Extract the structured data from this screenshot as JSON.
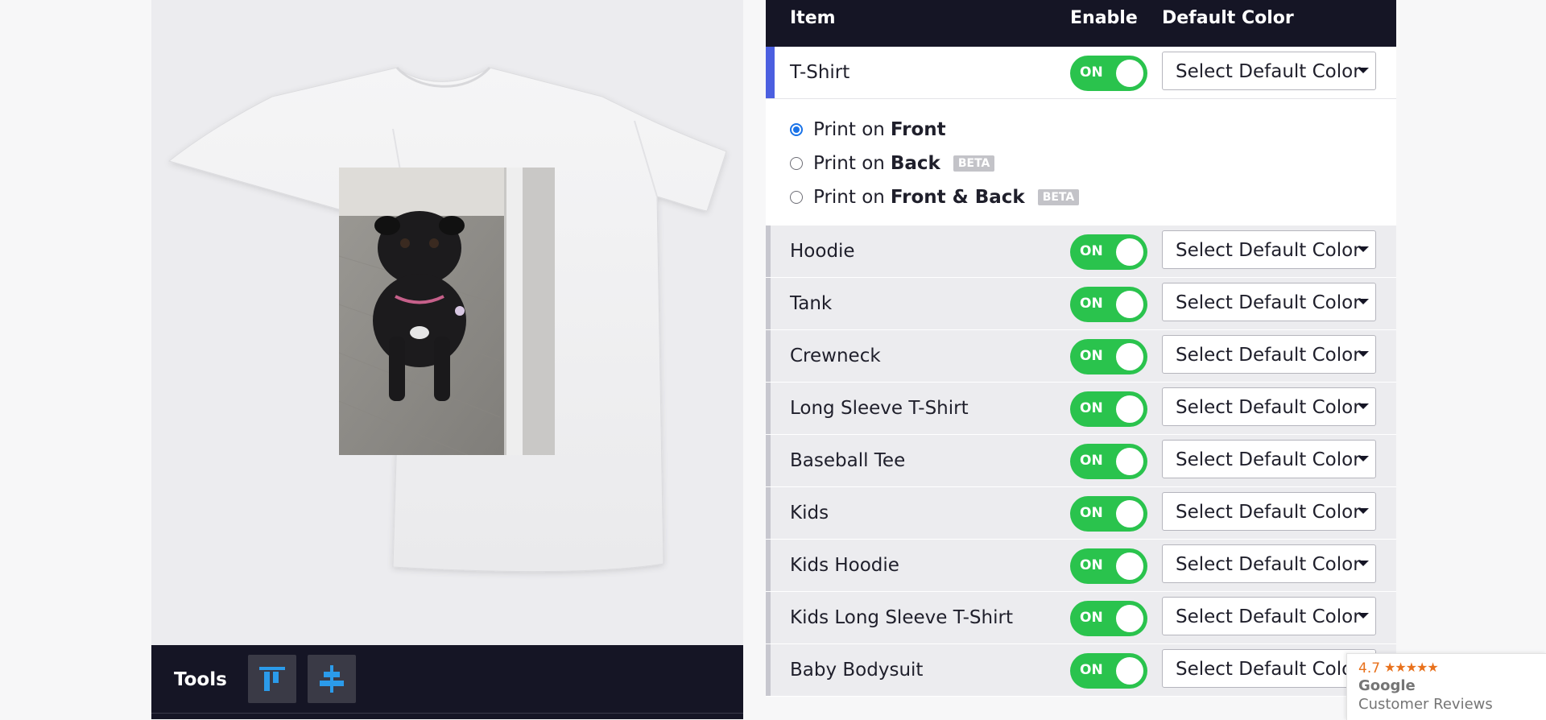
{
  "preview": {
    "tools_label": "Tools",
    "tool_buttons": [
      {
        "icon": "align-top-icon"
      },
      {
        "icon": "align-center-icon"
      }
    ]
  },
  "table": {
    "headers": {
      "item": "Item",
      "enable": "Enable",
      "default_color": "Default Color"
    },
    "select_placeholder": "Select Default Color",
    "toggle_label": "ON",
    "rows": [
      {
        "label": "T-Shirt",
        "enabled": true,
        "active": true
      },
      {
        "label": "Hoodie",
        "enabled": true
      },
      {
        "label": "Tank",
        "enabled": true
      },
      {
        "label": "Crewneck",
        "enabled": true
      },
      {
        "label": "Long Sleeve T-Shirt",
        "enabled": true
      },
      {
        "label": "Baseball Tee",
        "enabled": true
      },
      {
        "label": "Kids",
        "enabled": true
      },
      {
        "label": "Kids Hoodie",
        "enabled": true
      },
      {
        "label": "Kids Long Sleeve T-Shirt",
        "enabled": true
      },
      {
        "label": "Baby Bodysuit",
        "enabled": true
      }
    ],
    "print_options": [
      {
        "prefix": "Print on",
        "bold": "Front",
        "beta": "",
        "checked": true
      },
      {
        "prefix": "Print on",
        "bold": "Back",
        "beta": "BETA",
        "checked": false
      },
      {
        "prefix": "Print on",
        "bold": "Front & Back",
        "beta": "BETA",
        "checked": false
      }
    ]
  },
  "google_badge": {
    "rating": "4.7",
    "stars": "★★★★★",
    "line1": "Google",
    "line2": "Customer Reviews"
  },
  "colors": {
    "header_bg": "#151525",
    "toggle_on": "#2ac34d",
    "active_accent": "#4b5fe0",
    "radio_checked": "#1a73e8",
    "tool_icon": "#2b9bea"
  }
}
